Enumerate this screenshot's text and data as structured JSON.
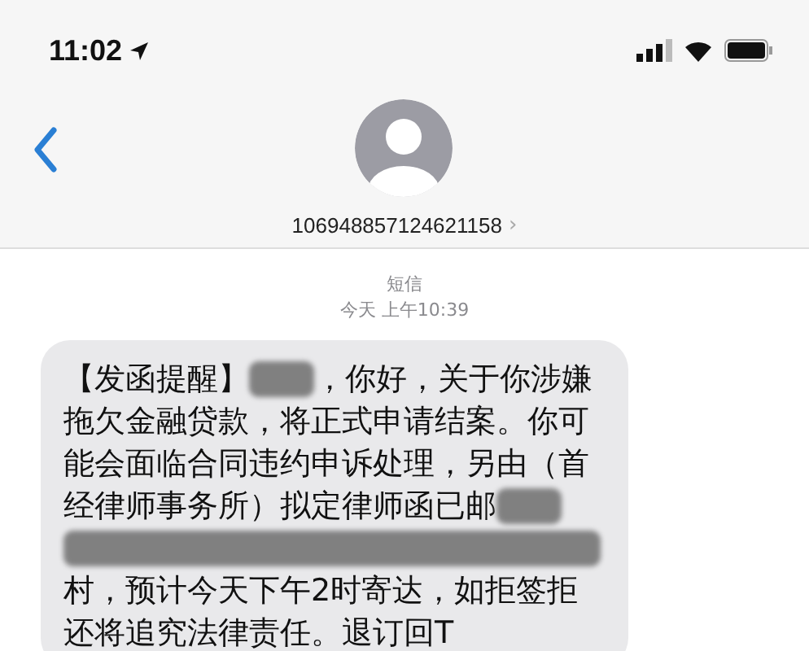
{
  "status_bar": {
    "time": "11:02"
  },
  "contact": {
    "number": "106948857124621158",
    "chevron": "›"
  },
  "thread": {
    "service": "短信",
    "timestamp": "今天 上午10:39"
  },
  "message": {
    "lines": [
      {
        "segments": [
          {
            "kind": "text",
            "text": "【发函提醒】"
          },
          {
            "kind": "redacted"
          },
          {
            "kind": "text",
            "text": "，你好，关于你涉嫌"
          }
        ]
      },
      {
        "segments": [
          {
            "kind": "text",
            "text": "拖欠金融贷款，将正式申请结案。你可"
          }
        ]
      },
      {
        "segments": [
          {
            "kind": "text",
            "text": "能会面临合同违约申诉处理，另由（首"
          }
        ]
      },
      {
        "segments": [
          {
            "kind": "text",
            "text": "经律师事务所）拟定律师函已邮"
          },
          {
            "kind": "redacted"
          }
        ]
      },
      {
        "segments": [
          {
            "kind": "redacted"
          }
        ]
      },
      {
        "segments": [
          {
            "kind": "text",
            "text": "村，预计今天下午2时寄达，如拒签拒"
          }
        ]
      },
      {
        "segments": [
          {
            "kind": "text",
            "text": "还将追究法律责任。退订回T"
          }
        ]
      }
    ]
  }
}
